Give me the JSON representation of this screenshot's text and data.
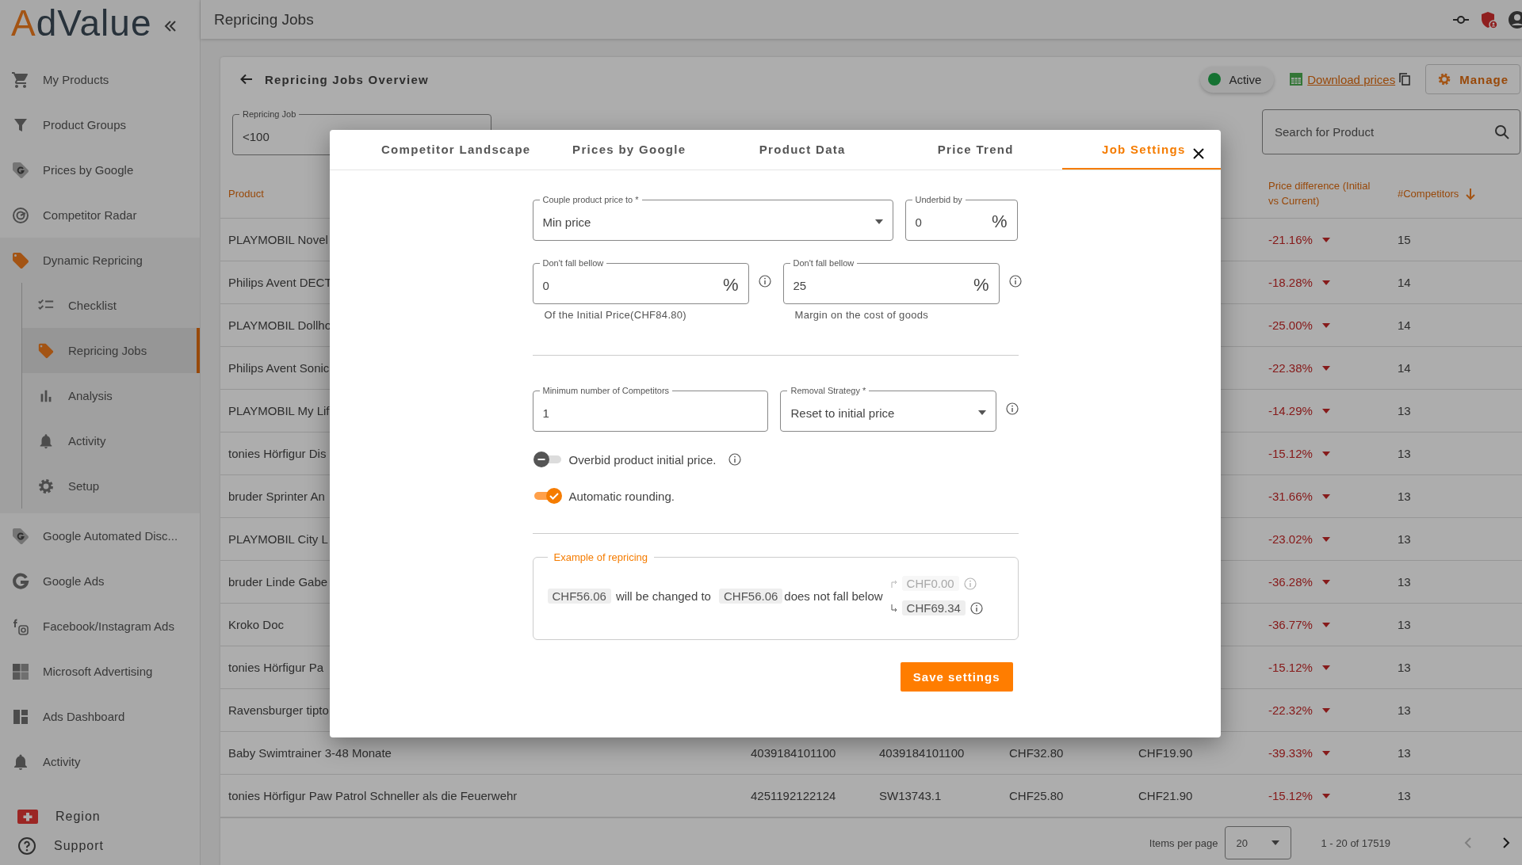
{
  "sidebar": {
    "logo": "AdValue",
    "items": [
      {
        "label": "My Products",
        "selected": false
      },
      {
        "label": "Product Groups",
        "selected": false
      },
      {
        "label": "Prices by Google",
        "selected": false
      },
      {
        "label": "Competitor Radar",
        "selected": false
      },
      {
        "label": "Dynamic Repricing",
        "selected": false,
        "expanded": true,
        "children": [
          {
            "label": "Checklist",
            "selected": false
          },
          {
            "label": "Repricing Jobs",
            "selected": true
          },
          {
            "label": "Analysis",
            "selected": false
          },
          {
            "label": "Activity",
            "selected": false
          },
          {
            "label": "Setup",
            "selected": false
          }
        ]
      },
      {
        "label": "Google Automated Disc...",
        "selected": false
      },
      {
        "label": "Google Ads",
        "selected": false
      },
      {
        "label": "Facebook/Instagram Ads",
        "selected": false
      },
      {
        "label": "Microsoft Advertising",
        "selected": false
      },
      {
        "label": "Ads Dashboard",
        "selected": false
      },
      {
        "label": "Activity",
        "selected": false
      }
    ],
    "footer": [
      {
        "label": "Region"
      },
      {
        "label": "Support"
      }
    ]
  },
  "header": {
    "title": "Repricing Jobs"
  },
  "overview": {
    "title": "Repricing Jobs Overview",
    "status": {
      "label": "Active",
      "active": true
    },
    "download_link": "Download prices",
    "manage_button": "Manage",
    "job_field": {
      "label": "Repricing Job",
      "value": "<100"
    },
    "search": {
      "placeholder": "Search for Product"
    }
  },
  "table": {
    "columns": [
      {
        "label": "Product"
      },
      {},
      {},
      {},
      {},
      {
        "label": "Price difference (Initial vs Current)"
      },
      {
        "label": "#Competitors",
        "sorted": true
      }
    ],
    "rows": [
      {
        "product": "PLAYMOBIL Novel",
        "price_difference": "-21.16%",
        "competitors": "15"
      },
      {
        "product": "Philips Avent DECT",
        "price_difference": "-18.28%",
        "competitors": "14"
      },
      {
        "product": "PLAYMOBIL Dollho",
        "price_difference": "-25.00%",
        "competitors": "14"
      },
      {
        "product": "Philips Avent Sonic",
        "price_difference": "-22.38%",
        "competitors": "14"
      },
      {
        "product": "PLAYMOBIL My Lif",
        "price_difference": "-14.29%",
        "competitors": "13"
      },
      {
        "product": "tonies Hörfigur Dis",
        "price_difference": "-15.12%",
        "competitors": "13"
      },
      {
        "product": "bruder Sprinter An",
        "price_difference": "-31.66%",
        "competitors": "13"
      },
      {
        "product": "PLAYMOBIL City L",
        "price_difference": "-23.02%",
        "competitors": "13"
      },
      {
        "product": "bruder Linde Gabe",
        "price_difference": "-36.28%",
        "competitors": "13"
      },
      {
        "product": "Kroko Doc",
        "price_difference": "-36.77%",
        "competitors": "13"
      },
      {
        "product": "tonies Hörfigur Pa",
        "price_difference": "-15.12%",
        "competitors": "13"
      },
      {
        "product": "Ravensburger tipto",
        "price_difference": "-22.32%",
        "competitors": "13"
      },
      {
        "product": "Baby Swimtrainer 3-48 Monate",
        "column_2": "4039184101100",
        "column_3": "4039184101100",
        "column_4": "CHF32.80",
        "column_5": "CHF19.90",
        "price_difference": "-39.33%",
        "competitors": "13"
      },
      {
        "product": "tonies Hörfigur Paw Patrol Schneller als die Feuerwehr",
        "column_2": "4251192122124",
        "column_3": "SW13743.1",
        "column_4": "CHF25.80",
        "column_5": "CHF21.90",
        "price_difference": "-15.12%",
        "competitors": "13"
      }
    ]
  },
  "pagination": {
    "label": "Items per page",
    "page_size": "20",
    "range": "1 - 20 of 17519",
    "previous_disabled": true,
    "next_disabled": false
  },
  "dialog": {
    "tabs": [
      {
        "label": "Competitor Landscape",
        "selected": false
      },
      {
        "label": "Prices by Google",
        "selected": false
      },
      {
        "label": "Product Data",
        "selected": false
      },
      {
        "label": "Price Trend",
        "selected": false
      },
      {
        "label": "Job Settings",
        "selected": true
      }
    ],
    "couple_field": {
      "label": "Couple product price to *",
      "value": "Min price"
    },
    "underbid_field": {
      "label": "Underbid by",
      "value": "0",
      "unit": "%"
    },
    "floor_fields": [
      {
        "label": "Don't fall bellow",
        "value": "0",
        "unit": "%",
        "helper": "Of the Initial Price(CHF84.80)"
      },
      {
        "label": "Don't fall bellow",
        "value": "25",
        "unit": "%",
        "helper": "Margin on the cost of goods"
      }
    ],
    "min_competitors_field": {
      "label": "Minimum number of Competitors",
      "value": "1"
    },
    "removal_field": {
      "label": "Removal Strategy *",
      "value": "Reset to initial price"
    },
    "toggles": [
      {
        "label": "Overbid product initial price.",
        "on": false,
        "info": true
      },
      {
        "label": "Automatic rounding.",
        "on": true,
        "info": false
      }
    ],
    "example": {
      "title": "Example of repricing",
      "from": "CHF56.06",
      "changed_text": "will be changed to",
      "to": "CHF56.06",
      "floor_text": "does not fall below",
      "floors": [
        {
          "value": "CHF0.00",
          "disabled": true
        },
        {
          "value": "CHF69.34",
          "disabled": false
        }
      ]
    },
    "save_button": "Save settings"
  }
}
